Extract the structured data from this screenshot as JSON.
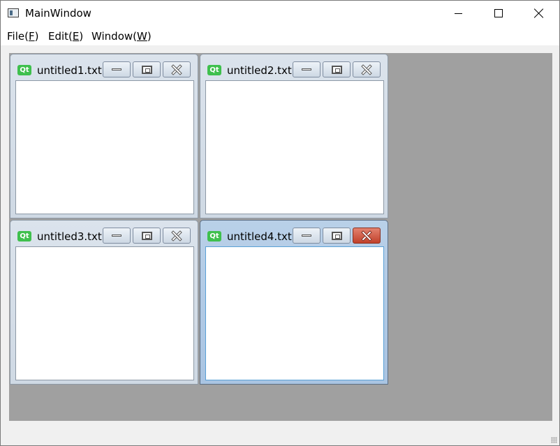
{
  "window": {
    "title": "MainWindow"
  },
  "menubar": {
    "items": [
      {
        "label": "File(",
        "accel": "F",
        "suffix": ")"
      },
      {
        "label": "Edit(",
        "accel": "E",
        "suffix": ")"
      },
      {
        "label": "Window(",
        "accel": "W",
        "suffix": ")"
      }
    ]
  },
  "subwindows": [
    {
      "title": "untitled1.txt",
      "icon_text": "Qt",
      "active": false
    },
    {
      "title": "untitled2.txt",
      "icon_text": "Qt",
      "active": false
    },
    {
      "title": "untitled3.txt",
      "icon_text": "Qt",
      "active": false
    },
    {
      "title": "untitled4.txt",
      "icon_text": "Qt",
      "active": true
    }
  ],
  "colors": {
    "mdi_background": "#a0a0a0",
    "active_close": "#c1402a",
    "qt_icon": "#3fc04d"
  },
  "icons": {
    "app": "app-window-icon",
    "minimize": "minimize-icon",
    "maximize": "maximize-icon",
    "close": "close-icon"
  }
}
